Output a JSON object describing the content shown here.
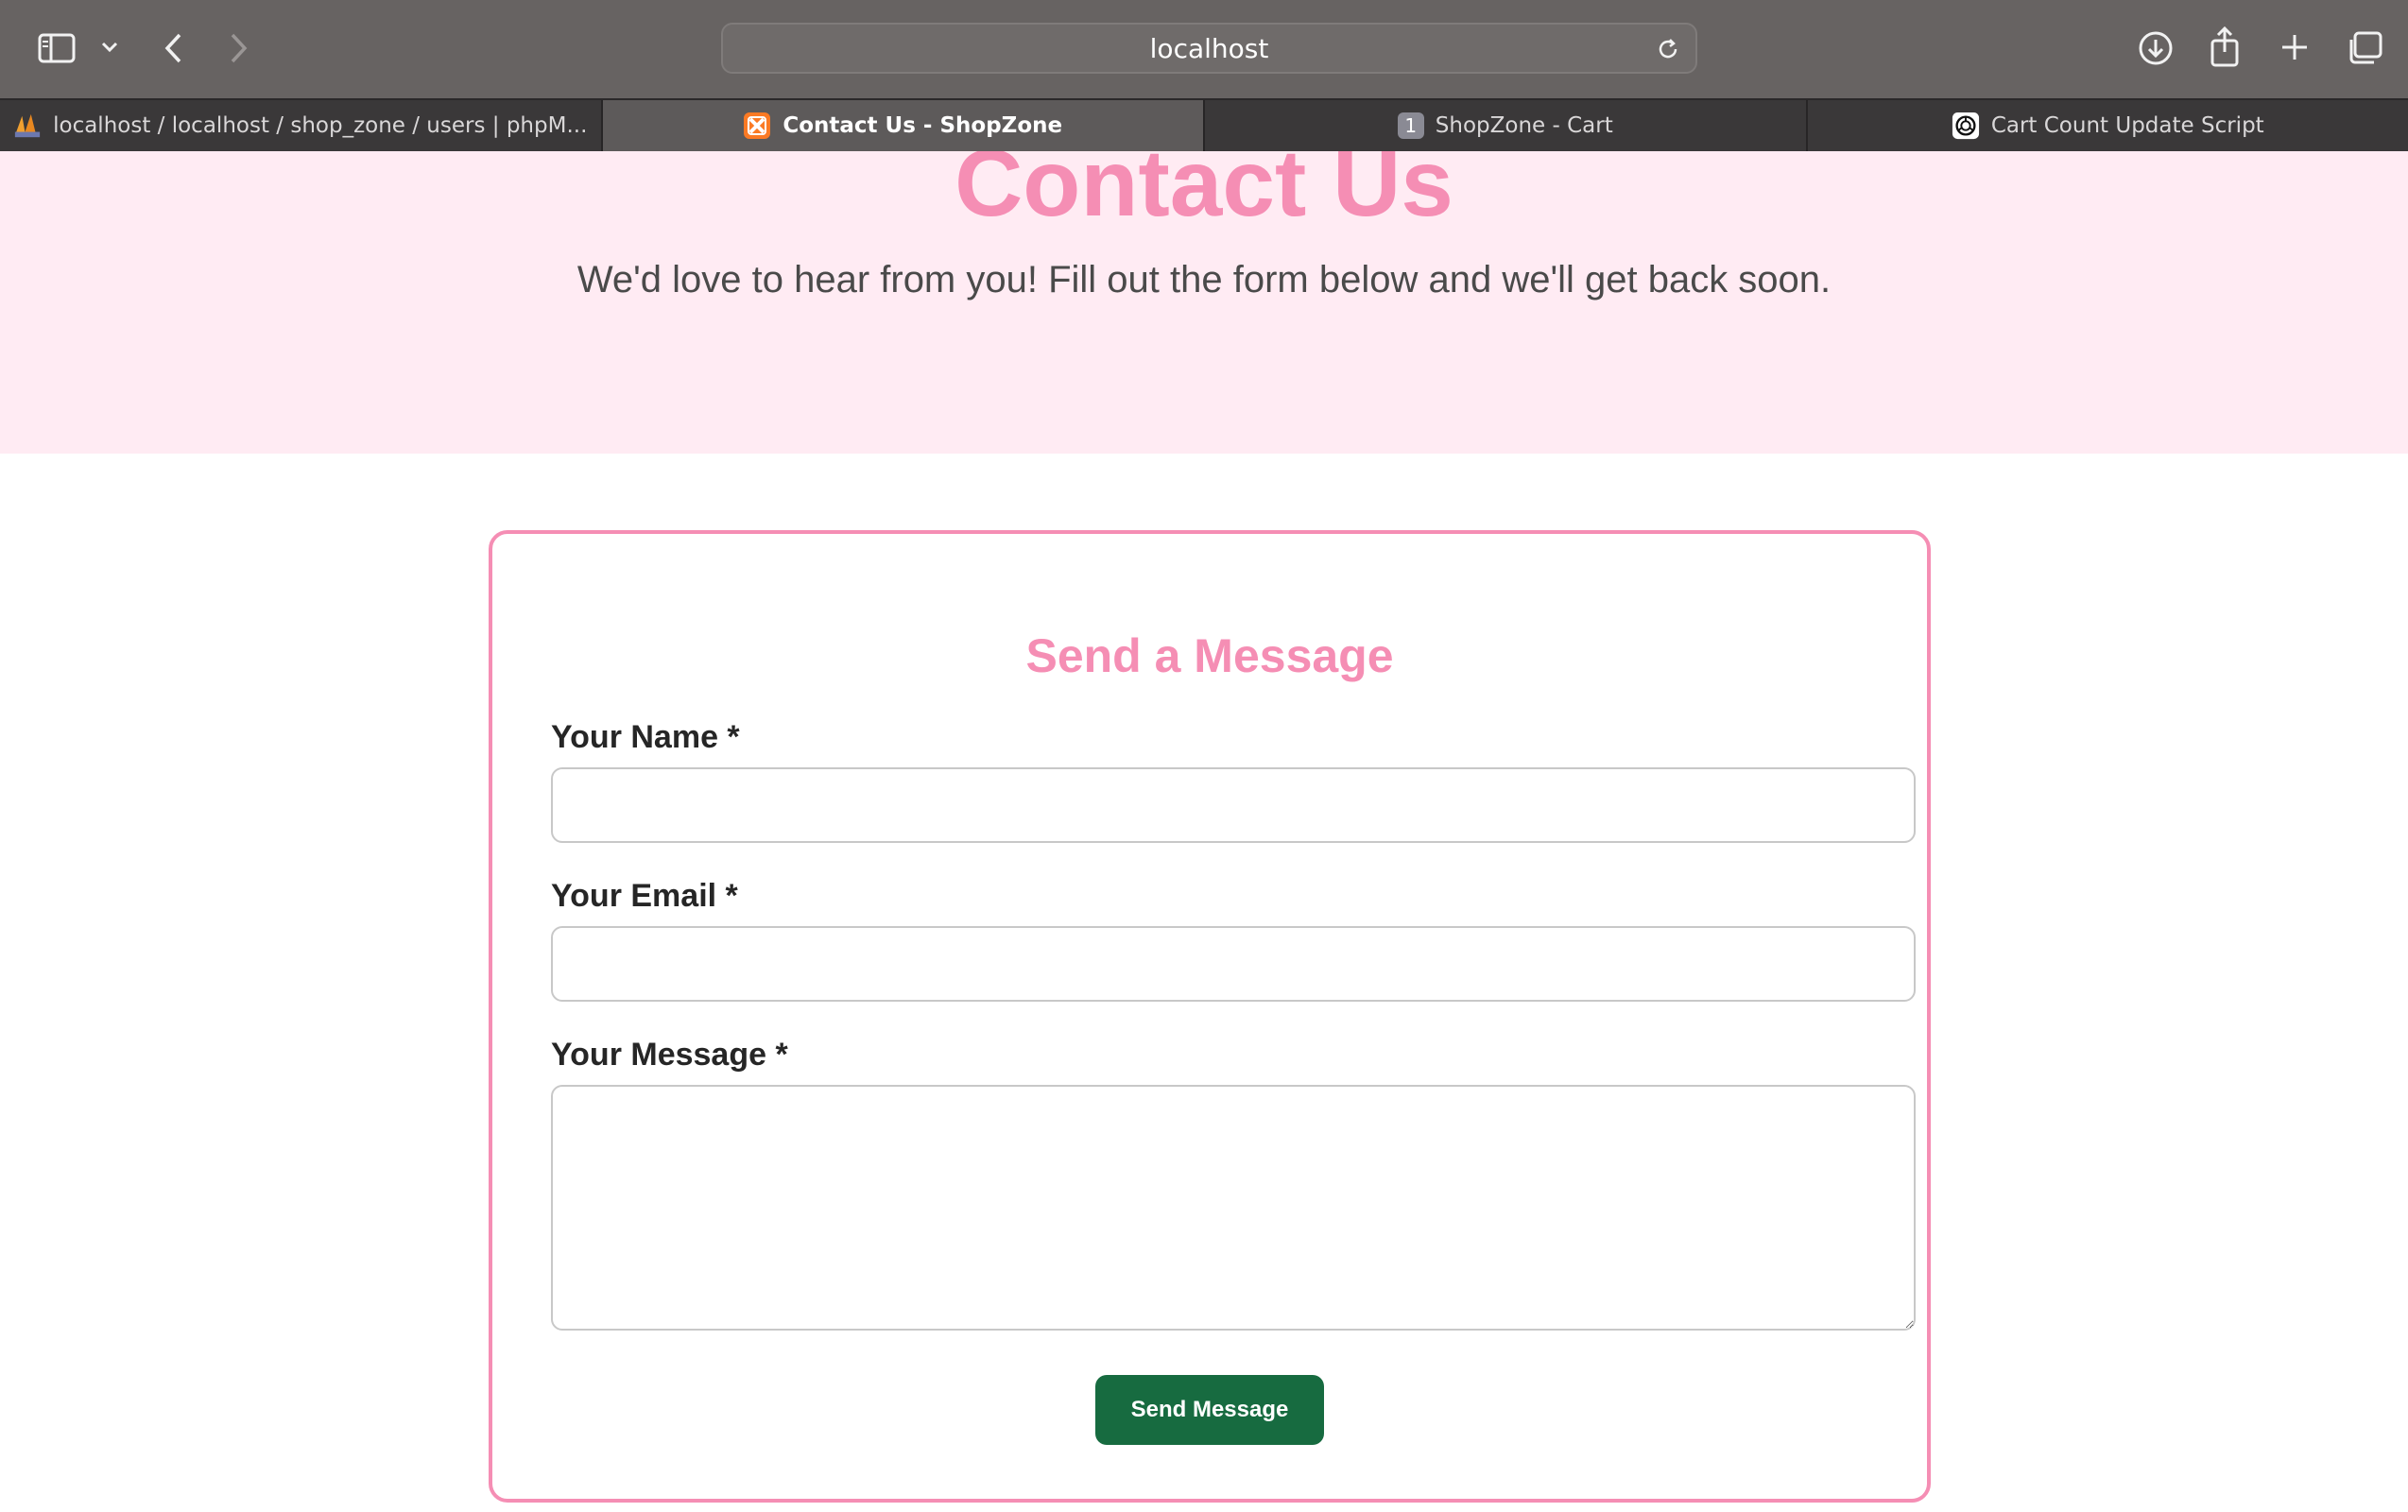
{
  "browser": {
    "address": "localhost",
    "tabs": [
      {
        "label": "localhost / localhost / shop_zone / users | phpM...",
        "icon": "phpmyadmin-icon"
      },
      {
        "label": "Contact Us - ShopZone",
        "icon": "xampp-icon",
        "active": true
      },
      {
        "label": "ShopZone - Cart",
        "icon": "tab-badge-icon",
        "badge": "1"
      },
      {
        "label": "Cart Count Update Script",
        "icon": "openai-icon"
      }
    ]
  },
  "hero": {
    "title": "Contact Us",
    "subtitle": "We'd love to hear from you! Fill out the form below and we'll get back soon."
  },
  "form": {
    "heading": "Send a Message",
    "name_label": "Your Name *",
    "name_value": "",
    "email_label": "Your Email *",
    "email_value": "",
    "message_label": "Your Message *",
    "message_value": "",
    "submit_label": "Send Message"
  },
  "colors": {
    "accent_pink": "#f58eb4",
    "hero_bg": "#ffebf3",
    "button_green": "#176b40"
  }
}
